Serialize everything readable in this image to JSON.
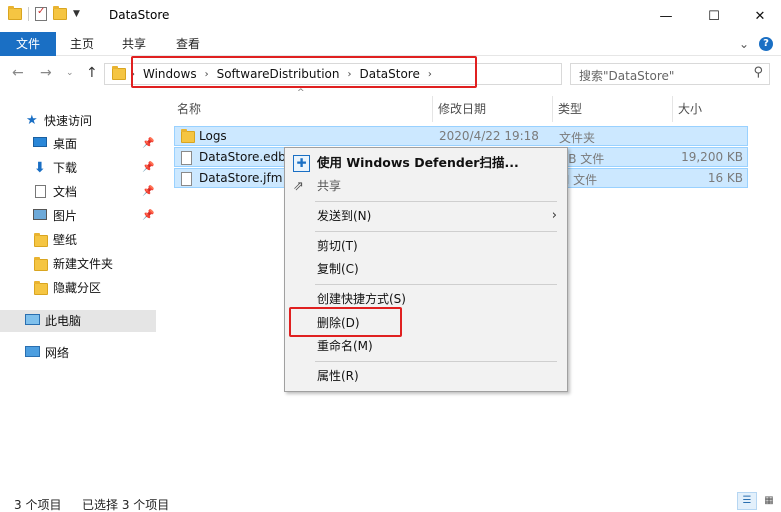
{
  "window": {
    "title": "DataStore",
    "minimize_glyph": "—",
    "maximize_glyph": "☐",
    "close_glyph": "✕"
  },
  "ribbon": {
    "tabs": [
      {
        "label": "文件"
      },
      {
        "label": "主页"
      },
      {
        "label": "共享"
      },
      {
        "label": "查看"
      }
    ],
    "collapse_glyph": "⌄",
    "help_glyph": "?"
  },
  "address": {
    "crumbs": [
      "Windows",
      "SoftwareDistribution",
      "DataStore"
    ],
    "search_placeholder": "搜索\"DataStore\""
  },
  "navpane": {
    "quick_access": "快速访问",
    "items": [
      {
        "label": "桌面",
        "icon": "desktop-icon",
        "pinned": true
      },
      {
        "label": "下载",
        "icon": "download-icon",
        "pinned": true
      },
      {
        "label": "文档",
        "icon": "document-icon",
        "pinned": true
      },
      {
        "label": "图片",
        "icon": "picture-icon",
        "pinned": true
      },
      {
        "label": "壁纸",
        "icon": "folder-icon",
        "pinned": false
      },
      {
        "label": "新建文件夹",
        "icon": "folder-icon",
        "pinned": false
      },
      {
        "label": "隐藏分区",
        "icon": "folder-icon",
        "pinned": false
      }
    ],
    "this_pc": "此电脑",
    "network": "网络"
  },
  "columns": {
    "name": "名称",
    "date": "修改日期",
    "type": "类型",
    "size": "大小"
  },
  "files": [
    {
      "name": "Logs",
      "date": "2020/4/22 19:18",
      "type": "文件夹",
      "size": "",
      "icon": "folder-icon"
    },
    {
      "name": "DataStore.edb",
      "date": "",
      "type": "DB 文件",
      "size": "19,200 KB",
      "icon": "file-icon"
    },
    {
      "name": "DataStore.jfm",
      "date": "",
      "type": "M 文件",
      "size": "16 KB",
      "icon": "file-icon"
    }
  ],
  "context_menu": {
    "scan": "使用 Windows Defender扫描...",
    "share": "共享",
    "send_to": "发送到(N)",
    "cut": "剪切(T)",
    "copy": "复制(C)",
    "create_shortcut": "创建快捷方式(S)",
    "delete": "删除(D)",
    "rename": "重命名(M)",
    "properties": "属性(R)"
  },
  "status": {
    "count": "3 个项目",
    "selected": "已选择 3 个项目"
  },
  "colors": {
    "accent": "#1a6fc4",
    "selection": "#cce8ff",
    "highlight_box": "#e02020"
  }
}
